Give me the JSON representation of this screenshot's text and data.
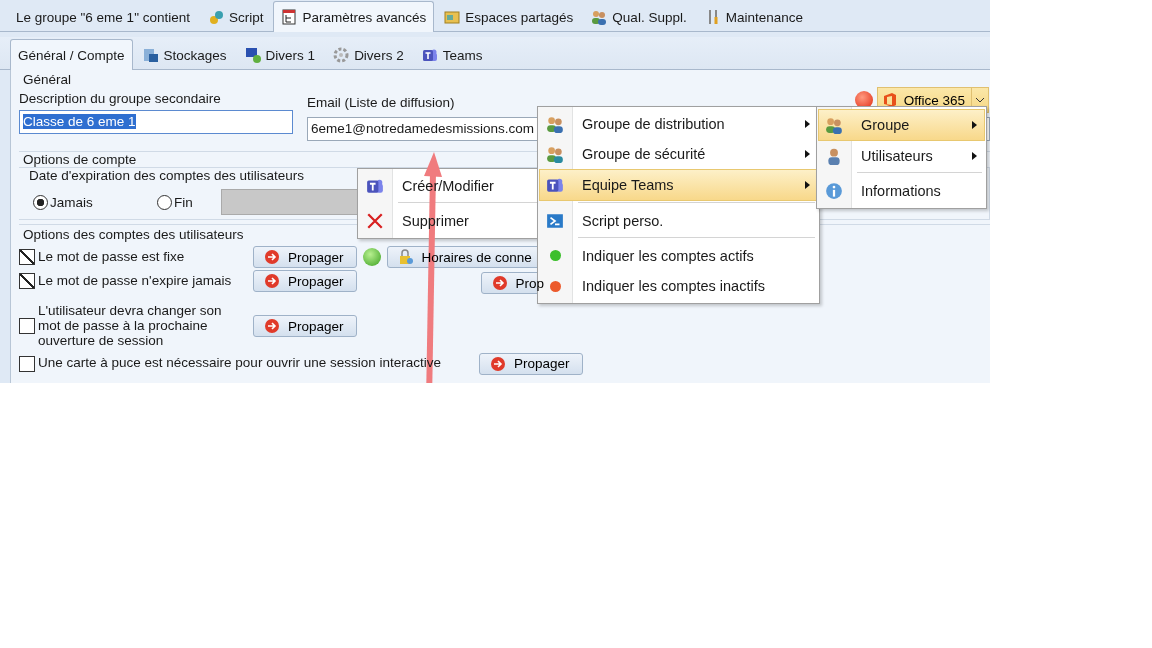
{
  "top_tabs": [
    {
      "label": "Le groupe \"6 eme 1\" contient",
      "selected": false
    },
    {
      "label": "Script",
      "selected": false
    },
    {
      "label": "Paramètres avancés",
      "selected": true
    },
    {
      "label": "Espaces partagés",
      "selected": false
    },
    {
      "label": "Qual. Suppl.",
      "selected": false
    },
    {
      "label": "Maintenance",
      "selected": false
    }
  ],
  "sub_tabs": [
    {
      "label": "Général / Compte",
      "selected": true
    },
    {
      "label": "Stockages",
      "selected": false
    },
    {
      "label": "Divers 1",
      "selected": false
    },
    {
      "label": "Divers 2",
      "selected": false
    },
    {
      "label": "Teams",
      "selected": false
    }
  ],
  "general": {
    "title": "Général",
    "description_label": "Description du groupe secondaire",
    "description_value": "Classe de 6 eme 1",
    "email_label": "Email (Liste de diffusion)",
    "email_value": "6eme1@notredamedesmissions.com",
    "office_button": "Office 365"
  },
  "account_options": {
    "title": "Options de compte",
    "expiry": {
      "title": "Date d'expiration des comptes des utilisateurs",
      "options": [
        {
          "label": "Jamais",
          "selected": true
        },
        {
          "label": "Fin",
          "selected": false
        }
      ]
    },
    "user_options": {
      "title": "Options des comptes des utilisateurs",
      "rows": [
        {
          "label": "Le mot de passe est fixe",
          "checked": true,
          "button": "Propager"
        },
        {
          "label": "Le mot de passe n'expire jamais",
          "checked": true,
          "button": "Propager"
        },
        {
          "label": "L'utilisateur devra changer son mot de passe à la prochaine ouverture de session",
          "checked": false,
          "button": "Propager"
        },
        {
          "label": "Une carte à puce est nécessaire pour ouvrir une session interactive",
          "checked": false,
          "button": "Propager"
        }
      ],
      "schedule_button": "Horaires de conne",
      "extra_button": "Prop"
    }
  },
  "teams_menu": [
    {
      "label": "Créer/Modifier",
      "separator_before": false
    },
    {
      "label": "Supprimer",
      "separator_before": true
    }
  ],
  "main_menu": [
    {
      "label": "Groupe de distribution",
      "submenu": true,
      "selected": false,
      "separator_before": false
    },
    {
      "label": "Groupe de sécurité",
      "submenu": true,
      "selected": false,
      "separator_before": false
    },
    {
      "label": "Equipe Teams",
      "submenu": true,
      "selected": true,
      "separator_before": false
    },
    {
      "label": "Script perso.",
      "submenu": false,
      "selected": false,
      "separator_before": true
    },
    {
      "label": "Indiquer les comptes actifs",
      "submenu": false,
      "selected": false,
      "separator_before": true,
      "color": "#3cbf2c"
    },
    {
      "label": "Indiquer les comptes inactifs",
      "submenu": false,
      "selected": false,
      "separator_before": false,
      "color": "#ec5a2c"
    }
  ],
  "office_menu": [
    {
      "label": "Groupe",
      "submenu": true,
      "selected": true,
      "separator_before": false
    },
    {
      "label": "Utilisateurs",
      "submenu": true,
      "selected": false,
      "separator_before": false
    },
    {
      "label": "Informations",
      "submenu": false,
      "selected": false,
      "separator_before": true
    }
  ]
}
